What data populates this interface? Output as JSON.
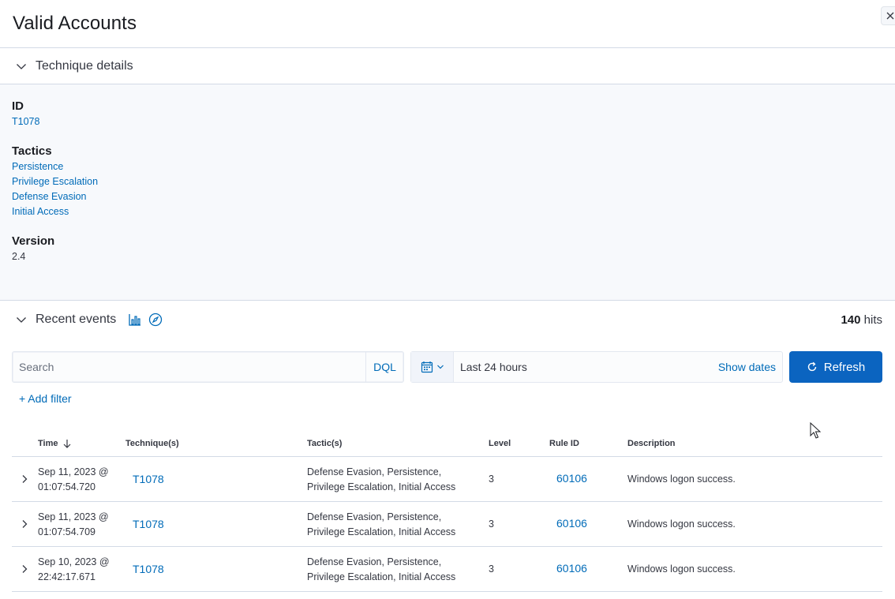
{
  "flyout": {
    "title": "Valid Accounts"
  },
  "technique_section": {
    "label": "Technique details"
  },
  "details": {
    "id_title": "ID",
    "id_value": "T1078",
    "tactics_title": "Tactics",
    "tactics": [
      "Persistence",
      "Privilege Escalation",
      "Defense Evasion",
      "Initial Access"
    ],
    "version_title": "Version",
    "version_value": "2.4"
  },
  "events_section": {
    "label": "Recent events",
    "hits_count": "140",
    "hits_label": "hits"
  },
  "search": {
    "placeholder": "Search",
    "language": "DQL"
  },
  "date_picker": {
    "range": "Last 24 hours",
    "show_dates": "Show dates"
  },
  "refresh": {
    "label": "Refresh"
  },
  "filter": {
    "add_label": "+ Add filter"
  },
  "table": {
    "columns": [
      "Time",
      "Technique(s)",
      "Tactic(s)",
      "Level",
      "Rule ID",
      "Description"
    ],
    "rows": [
      {
        "time_date": "Sep 11, 2023 @",
        "time_clock": "01:07:54.720",
        "technique": "T1078",
        "tactics_line1": "Defense Evasion, Persistence,",
        "tactics_line2": "Privilege Escalation, Initial Access",
        "level": "3",
        "rule_id": "60106",
        "description": "Windows logon success."
      },
      {
        "time_date": "Sep 11, 2023 @",
        "time_clock": "01:07:54.709",
        "technique": "T1078",
        "tactics_line1": "Defense Evasion, Persistence,",
        "tactics_line2": "Privilege Escalation, Initial Access",
        "level": "3",
        "rule_id": "60106",
        "description": "Windows logon success."
      },
      {
        "time_date": "Sep 10, 2023 @",
        "time_clock": "22:42:17.671",
        "technique": "T1078",
        "tactics_line1": "Defense Evasion, Persistence,",
        "tactics_line2": "Privilege Escalation, Initial Access",
        "level": "3",
        "rule_id": "60106",
        "description": "Windows logon success."
      }
    ]
  },
  "colors": {
    "link": "#006bb8",
    "primary_button": "#0b64c0",
    "panel_bg": "#f7f9fc",
    "border": "#d3dae6"
  }
}
